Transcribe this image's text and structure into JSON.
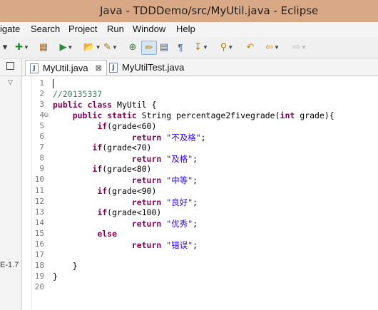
{
  "window": {
    "title": "Java - TDDDemo/src/MyUtil.java - Eclipse",
    "titlebar_color": "#d9a987"
  },
  "menu": [
    "igate",
    "Search",
    "Project",
    "Run",
    "Window",
    "Help"
  ],
  "toolbar_icons": [
    {
      "name": "new-dropdown-icon",
      "glyph": "▾"
    },
    {
      "name": "debug-run-icon",
      "glyph": "✚"
    },
    {
      "name": "build-icon",
      "glyph": "▦"
    },
    {
      "name": "run-icon",
      "glyph": "▶"
    },
    {
      "name": "open-folder-icon",
      "glyph": "📂"
    },
    {
      "name": "wand-icon",
      "glyph": "✎"
    },
    {
      "name": "new-package-icon",
      "glyph": "⊕"
    },
    {
      "name": "highlight-icon",
      "glyph": "✏"
    },
    {
      "name": "block-icon",
      "glyph": "▤"
    },
    {
      "name": "paragraph-icon",
      "glyph": "¶"
    },
    {
      "name": "annotation-next-icon",
      "glyph": "↧"
    },
    {
      "name": "pin-icon",
      "glyph": "⚲"
    },
    {
      "name": "back-history-icon",
      "glyph": "↶"
    },
    {
      "name": "back-icon",
      "glyph": "⇦"
    },
    {
      "name": "forward-icon",
      "glyph": "⇨"
    }
  ],
  "left_panel": {
    "jre_label": "E-1.7"
  },
  "tabs": [
    {
      "label": "MyUtil.java",
      "active": true,
      "close": "⊠"
    },
    {
      "label": "MyUtilTest.java",
      "active": false
    }
  ],
  "editor": {
    "lines": [
      {
        "num": "1",
        "segs": []
      },
      {
        "num": "2",
        "segs": [
          {
            "t": "//20135337",
            "c": "cm"
          }
        ]
      },
      {
        "num": "3",
        "segs": [
          {
            "t": "public",
            "c": "kw"
          },
          {
            "t": " "
          },
          {
            "t": "class",
            "c": "kw"
          },
          {
            "t": " MyUtil {"
          }
        ]
      },
      {
        "num": "4",
        "fold": "⊖",
        "segs": [
          {
            "t": "    "
          },
          {
            "t": "public",
            "c": "kw"
          },
          {
            "t": " "
          },
          {
            "t": "static",
            "c": "kw"
          },
          {
            "t": " String percentage2fivegrade("
          },
          {
            "t": "int",
            "c": "kw"
          },
          {
            "t": " grade){"
          }
        ]
      },
      {
        "num": "5",
        "segs": [
          {
            "t": "         "
          },
          {
            "t": "if",
            "c": "kw"
          },
          {
            "t": "(grade<60)"
          }
        ]
      },
      {
        "num": "6",
        "segs": [
          {
            "t": "                "
          },
          {
            "t": "return",
            "c": "kw"
          },
          {
            "t": " "
          },
          {
            "t": "\"不及格\"",
            "c": "st"
          },
          {
            "t": ";"
          }
        ]
      },
      {
        "num": "7",
        "segs": [
          {
            "t": "        "
          },
          {
            "t": "if",
            "c": "kw"
          },
          {
            "t": "(grade<70)"
          }
        ]
      },
      {
        "num": "8",
        "segs": [
          {
            "t": "                "
          },
          {
            "t": "return",
            "c": "kw"
          },
          {
            "t": " "
          },
          {
            "t": "\"及格\"",
            "c": "st"
          },
          {
            "t": ";"
          }
        ]
      },
      {
        "num": "9",
        "segs": [
          {
            "t": "        "
          },
          {
            "t": "if",
            "c": "kw"
          },
          {
            "t": "(grade<80)"
          }
        ]
      },
      {
        "num": "10",
        "segs": [
          {
            "t": "                "
          },
          {
            "t": "return",
            "c": "kw"
          },
          {
            "t": " "
          },
          {
            "t": "\"中等\"",
            "c": "st"
          },
          {
            "t": ";"
          }
        ]
      },
      {
        "num": "11",
        "segs": [
          {
            "t": "         "
          },
          {
            "t": "if",
            "c": "kw"
          },
          {
            "t": "(grade<90)"
          }
        ]
      },
      {
        "num": "12",
        "segs": [
          {
            "t": "                "
          },
          {
            "t": "return",
            "c": "kw"
          },
          {
            "t": " "
          },
          {
            "t": "\"良好\"",
            "c": "st"
          },
          {
            "t": ";"
          }
        ]
      },
      {
        "num": "13",
        "segs": [
          {
            "t": "         "
          },
          {
            "t": "if",
            "c": "kw"
          },
          {
            "t": "(grade<100)"
          }
        ]
      },
      {
        "num": "14",
        "segs": [
          {
            "t": "                "
          },
          {
            "t": "return",
            "c": "kw"
          },
          {
            "t": " "
          },
          {
            "t": "\"优秀\"",
            "c": "st"
          },
          {
            "t": ";"
          }
        ]
      },
      {
        "num": "15",
        "segs": [
          {
            "t": "         "
          },
          {
            "t": "else",
            "c": "kw"
          }
        ]
      },
      {
        "num": "16",
        "segs": [
          {
            "t": "                "
          },
          {
            "t": "return",
            "c": "kw"
          },
          {
            "t": " "
          },
          {
            "t": "\"错误\"",
            "c": "st"
          },
          {
            "t": ";"
          }
        ]
      },
      {
        "num": "17",
        "segs": []
      },
      {
        "num": "18",
        "segs": [
          {
            "t": "    }"
          }
        ]
      },
      {
        "num": "19",
        "segs": [
          {
            "t": "}"
          }
        ]
      },
      {
        "num": "20",
        "segs": []
      }
    ]
  }
}
